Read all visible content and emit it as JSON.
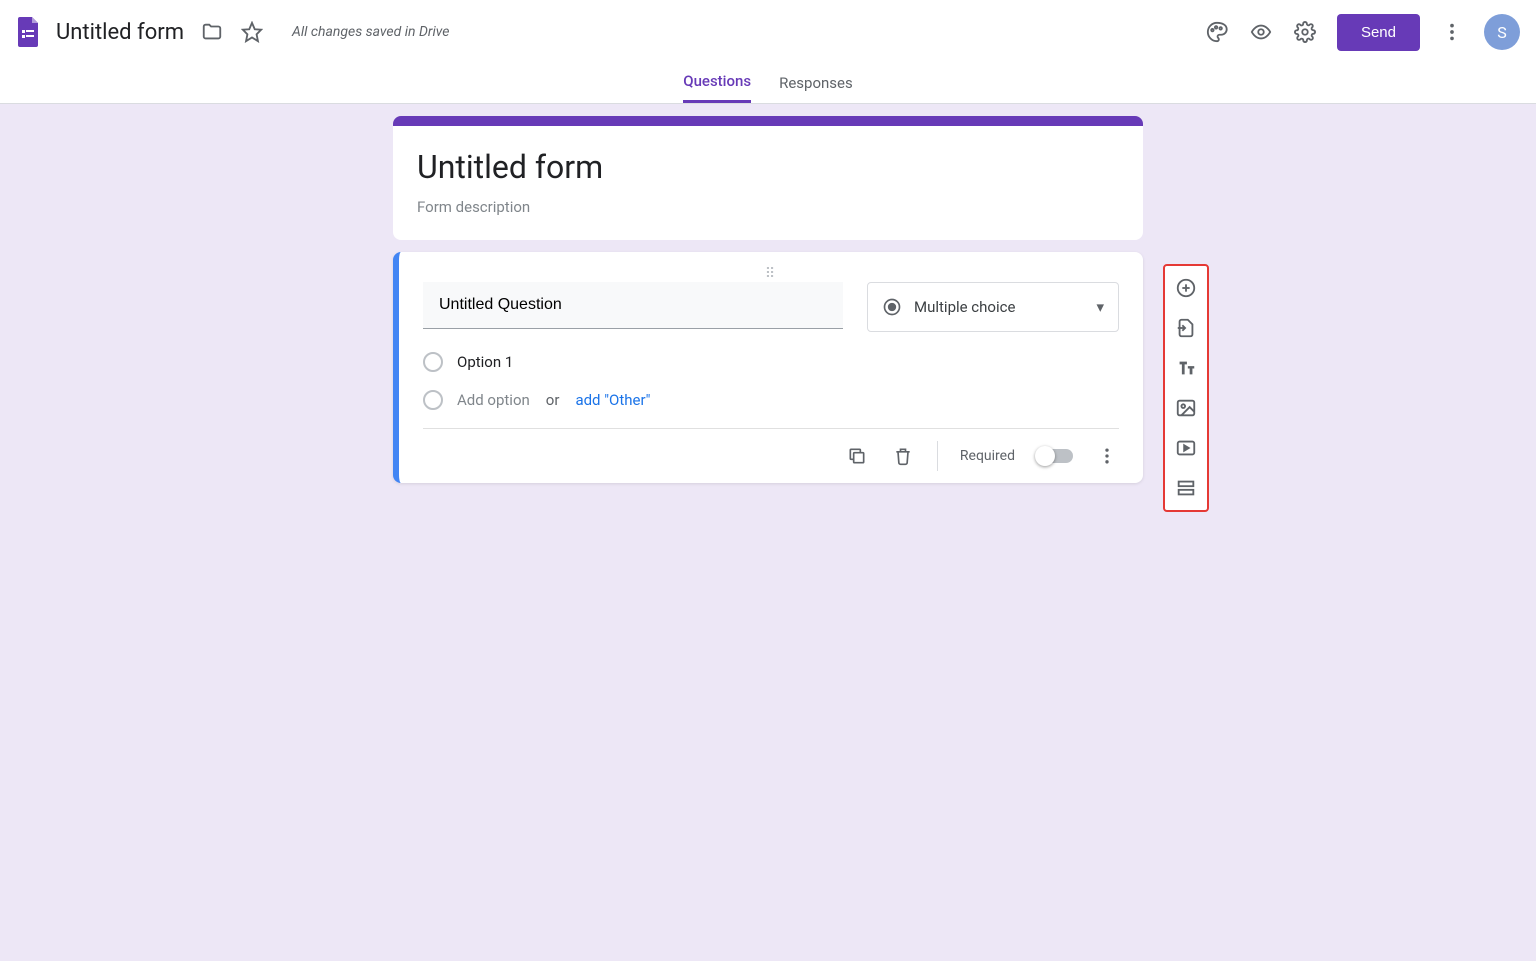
{
  "header": {
    "title": "Untitled form",
    "save_status": "All changes saved in Drive",
    "send_label": "Send",
    "avatar_initial": "S"
  },
  "tabs": {
    "questions": "Questions",
    "responses": "Responses"
  },
  "form": {
    "title": "Untitled form",
    "description_placeholder": "Form description"
  },
  "question": {
    "title": "Untitled Question",
    "type_label": "Multiple choice",
    "option1": "Option 1",
    "add_option": "Add option",
    "or": "or",
    "add_other": "add \"Other\"",
    "required_label": "Required"
  },
  "toolbar": {
    "add_question": "add-question",
    "import_questions": "import-questions",
    "add_title": "add-title",
    "add_image": "add-image",
    "add_video": "add-video",
    "add_section": "add-section"
  }
}
